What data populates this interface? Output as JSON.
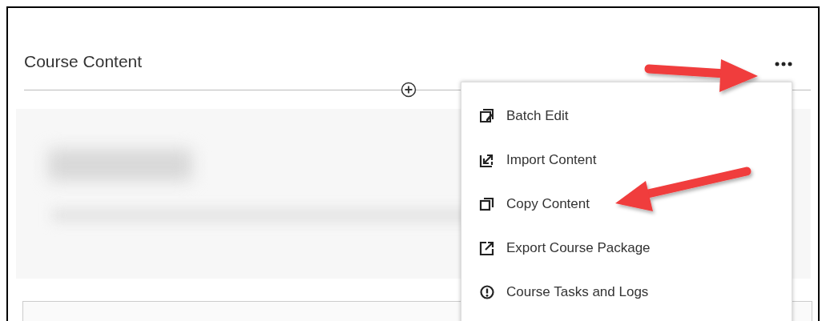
{
  "page": {
    "title": "Course Content"
  },
  "menu": {
    "items": [
      {
        "kind": "batch-edit",
        "label": "Batch Edit"
      },
      {
        "kind": "import",
        "label": "Import Content"
      },
      {
        "kind": "copy",
        "label": "Copy Content"
      },
      {
        "kind": "export",
        "label": "Export Course Package"
      },
      {
        "kind": "tasks",
        "label": "Course Tasks and Logs"
      }
    ]
  }
}
